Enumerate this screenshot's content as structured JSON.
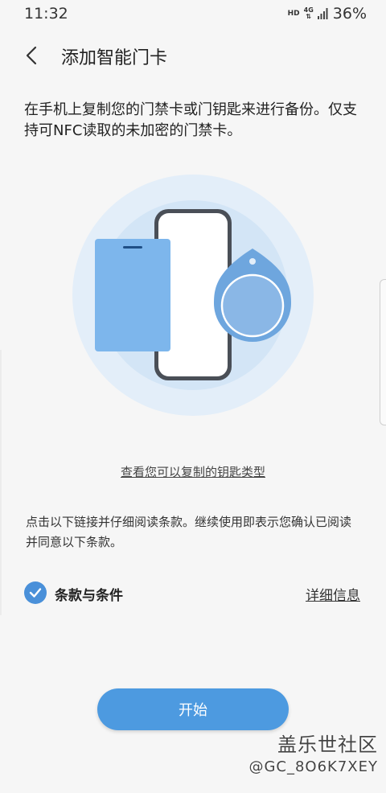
{
  "status_bar": {
    "time": "11:32",
    "hd": "HD",
    "network": "4G",
    "battery": "36%"
  },
  "header": {
    "title": "添加智能门卡"
  },
  "description": "在手机上复制您的门禁卡或门钥匙来进行备份。仅支持可NFC读取的未加密的门禁卡。",
  "key_types_link": "查看您可以复制的钥匙类型",
  "terms_description": "点击以下链接并仔细阅读条款。继续使用即表示您确认已阅读并同意以下条款。",
  "terms": {
    "label": "条款与条件",
    "checked": true,
    "details_link": "详细信息"
  },
  "start_button": "开始",
  "watermark": {
    "site": "盖乐世社区",
    "user": "@GC_8O6K7XEY"
  },
  "colors": {
    "accent": "#4d9ae0",
    "background": "#f6f6f6",
    "illustration_circle_outer": "#e3eef9",
    "illustration_circle_inner": "#d3e5f6",
    "card": "#7db6ec",
    "key_fob": "#6ea6de"
  }
}
